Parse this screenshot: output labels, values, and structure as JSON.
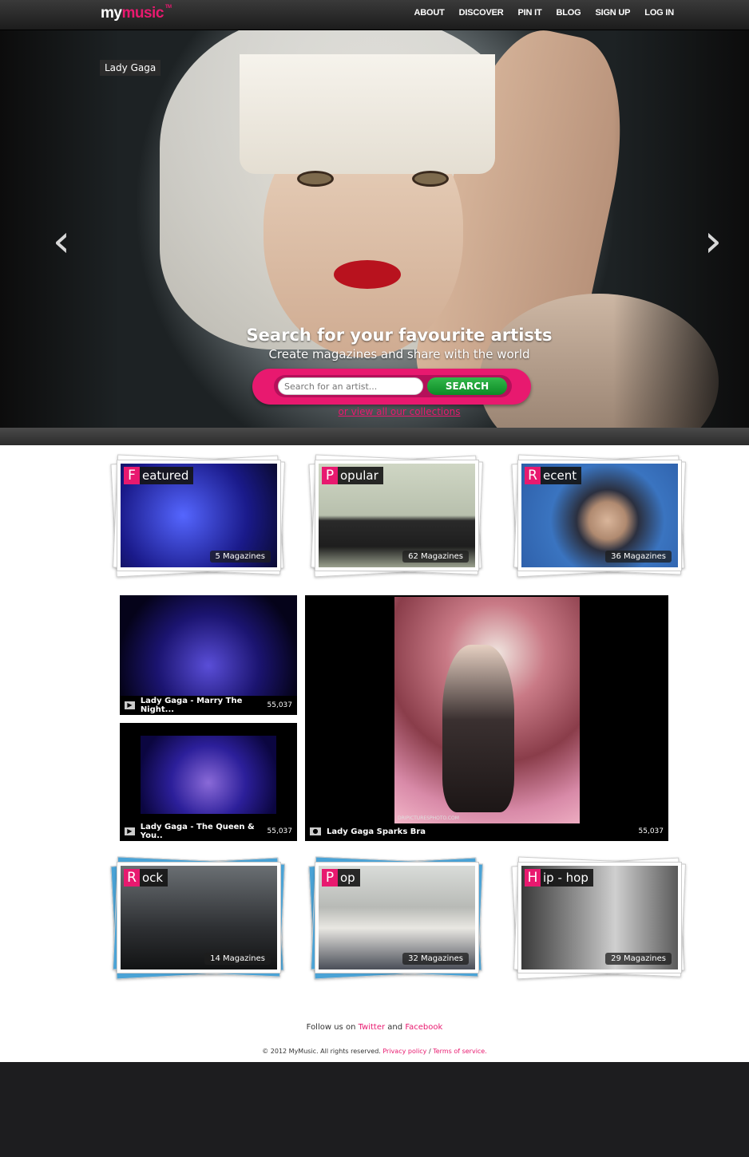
{
  "brand": {
    "logo_my": "my",
    "logo_music": "music",
    "logo_tm": "TM",
    "accent": "#e8196f"
  },
  "nav": {
    "items": [
      "ABOUT",
      "DISCOVER",
      "PIN IT",
      "BLOG",
      "SIGN UP",
      "LOG IN"
    ]
  },
  "hero": {
    "artist_label": "Lady Gaga",
    "title": "Search for your favourite artists",
    "subtitle": "Create magazines and share with the world",
    "search_placeholder": "Search for an artist...",
    "search_button": "SEARCH",
    "view_all_link": "or view all our collections",
    "prev_arrow": "‹",
    "next_arrow": "›"
  },
  "collections_top": [
    {
      "initial": "F",
      "rest": "eatured",
      "count": "5 Magazines"
    },
    {
      "initial": "P",
      "rest": "opular",
      "count": "62 Magazines"
    },
    {
      "initial": "R",
      "rest": "ecent",
      "count": "36 Magazines"
    }
  ],
  "media": [
    {
      "title": "Lady Gaga - Marry The Night...",
      "views": "55,037",
      "kind": "video"
    },
    {
      "title": "Lady Gaga - The Queen & You..",
      "views": "55,037",
      "kind": "video"
    },
    {
      "title": "Lady Gaga Sparks Bra",
      "views": "55,037",
      "kind": "photo",
      "watermark": "DRIPICTURESPHOTO.COM"
    }
  ],
  "collections_bottom": [
    {
      "initial": "R",
      "rest": "ock",
      "count": "14 Magazines"
    },
    {
      "initial": "P",
      "rest": "op",
      "count": "32 Magazines"
    },
    {
      "initial": "H",
      "rest": "ip - hop",
      "count": "29 Magazines"
    }
  ],
  "footer": {
    "follow_prefix": "Follow us on",
    "twitter": "Twitter",
    "and": "and",
    "facebook": "Facebook",
    "copyright": "© 2012 MyMusic. All rights reserved.",
    "privacy": "Privacy policy",
    "slash": "/",
    "terms": "Terms of service."
  }
}
